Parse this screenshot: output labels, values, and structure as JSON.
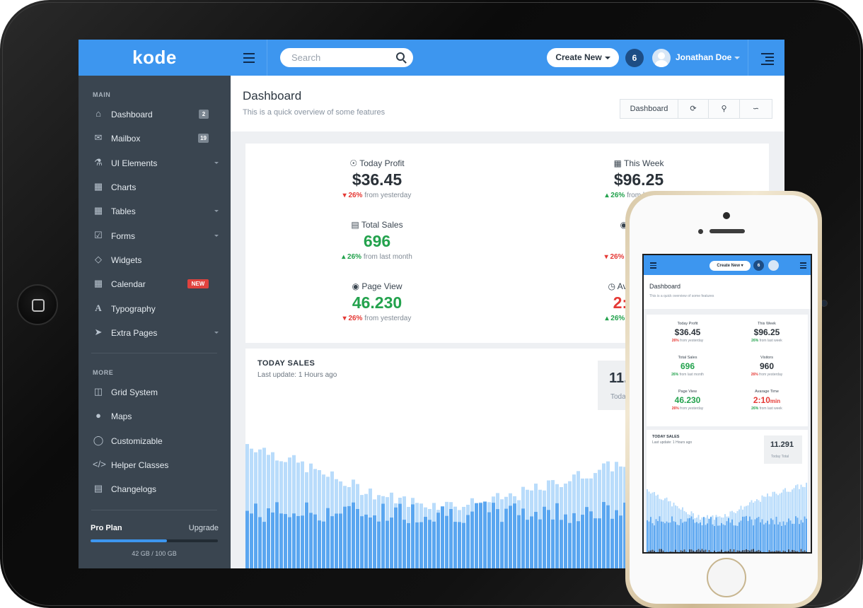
{
  "app": {
    "logo": "kode"
  },
  "topbar": {
    "search_placeholder": "Search",
    "create_label": "Create New",
    "notifications": "6",
    "user_name": "Jonathan Doe"
  },
  "sidebar": {
    "main_heading": "MAIN",
    "more_heading": "MORE",
    "items": [
      {
        "label": "Dashboard",
        "icon": "home-icon",
        "badge": "2"
      },
      {
        "label": "Mailbox",
        "icon": "envelope-icon",
        "badge": "19"
      },
      {
        "label": "UI Elements",
        "icon": "flask-icon"
      },
      {
        "label": "Charts",
        "icon": "bar-chart-icon"
      },
      {
        "label": "Tables",
        "icon": "grid-icon"
      },
      {
        "label": "Forms",
        "icon": "checkbox-icon"
      },
      {
        "label": "Widgets",
        "icon": "diamond-icon"
      },
      {
        "label": "Calendar",
        "icon": "calendar-icon",
        "badge": "NEW"
      },
      {
        "label": "Typography",
        "icon": "font-icon"
      },
      {
        "label": "Extra Pages",
        "icon": "paper-plane-icon"
      }
    ],
    "more_items": [
      {
        "label": "Grid System",
        "icon": "columns-icon"
      },
      {
        "label": "Maps",
        "icon": "map-pin-icon"
      },
      {
        "label": "Customizable",
        "icon": "lightbulb-icon"
      },
      {
        "label": "Helper Classes",
        "icon": "code-icon"
      },
      {
        "label": "Changelogs",
        "icon": "file-icon"
      }
    ],
    "plan": {
      "label": "Pro Plan",
      "upgrade": "Upgrade",
      "usage": "42 GB / 100 GB",
      "used_fraction": 0.6
    }
  },
  "page": {
    "title": "Dashboard",
    "subtitle": "This is a quick overview of some features",
    "toolbar": {
      "dashboard_label": "Dashboard"
    }
  },
  "stats": {
    "today_profit": {
      "label": "Today Profit",
      "value": "$36.45",
      "change": "26%",
      "change_text": "from yesterday",
      "direction": "down"
    },
    "this_week": {
      "label": "This Week",
      "value": "$96.25",
      "change": "26%",
      "change_text": "from last week",
      "direction": "up"
    },
    "total_sales": {
      "label": "Total Sales",
      "value": "696",
      "change": "26%",
      "change_text": "from last month",
      "direction": "up"
    },
    "visitors": {
      "label": "Visitors",
      "value": "960",
      "change": "26%",
      "change_text": "from yesterday",
      "direction": "down"
    },
    "page_view": {
      "label": "Page View",
      "value": "46.230",
      "change": "26%",
      "change_text": "from yesterday",
      "direction": "down"
    },
    "average_time": {
      "label": "Avarage Time",
      "value": "2:10",
      "unit": "min",
      "change": "26%",
      "change_text": "from last week",
      "direction": "up"
    }
  },
  "sales": {
    "title": "TODAY SALES",
    "subtitle": "Last update: 1 Hours ago",
    "total_value": "11.291",
    "total_label": "Today Total"
  },
  "colors": {
    "accent": "#3d96ef",
    "sidebar": "#3a4550",
    "up": "#23a24d",
    "down": "#e53935"
  }
}
